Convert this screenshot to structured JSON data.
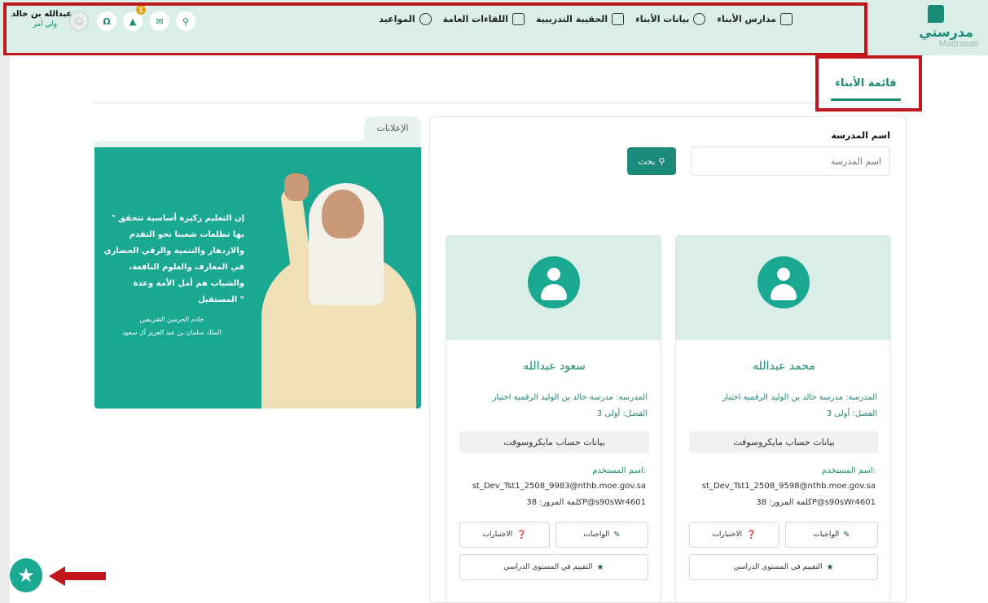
{
  "brand": {
    "name_ar": "مدرستي",
    "name_en": "Madrasati"
  },
  "nav": [
    {
      "label": "مدارس الأبناء",
      "icon": "school-icon"
    },
    {
      "label": "بيانات الأبناء",
      "icon": "children-icon"
    },
    {
      "label": "الحقيبة التدريبية",
      "icon": "bag-icon"
    },
    {
      "label": "اللقاءات العامة",
      "icon": "meeting-icon"
    },
    {
      "label": "المواعيد",
      "icon": "clock-icon"
    }
  ],
  "user": {
    "name": "عبدالله بن خالد",
    "role": "ولي أمر"
  },
  "toolbar": {
    "notifications_count": "1"
  },
  "tab": {
    "label": "قائمة الأبناء"
  },
  "announcements": {
    "tab_label": "الإعلانات",
    "quote": "\" إن التعليم ركيزة أساسية تتحقق بها تطلعات شعبنا نحو التقدم والازدهار والتنمية والرقي الحضاري في المعارف والعلوم النافعة، والشباب هم أمل الأمة وعدة المستقبل \"",
    "attribution_title": "خادم الحرمين الشريفين",
    "attribution_name": "الملك سلمان بن عبد العزيز آل سعود"
  },
  "search": {
    "label": "اسم المدرسة",
    "placeholder": "اسم المدرسة",
    "button": "بحث"
  },
  "children": [
    {
      "name": "محمد عبدالله",
      "school_label": "المدرسة:",
      "school": "مدرسة خالد بن الوليد الرقمية اختبار",
      "class_label": "الفصل:",
      "class": "أولى 3",
      "ms_title": "بيانات حساب مايكروسوفت",
      "username_label": "اسم المستخدم:",
      "username": "st_Dev_Tst1_2508_9598@nthb.moe.gov.sa",
      "password_label": "كلمة المرور:",
      "password": "38P@s90sWr4601",
      "homework": "الواجبات",
      "tests": "الاختبارات",
      "evaluation": "التقييم في المستوى الدراسي"
    },
    {
      "name": "سعود عبدالله",
      "school_label": "المدرسة:",
      "school": "مدرسة خالد بن الوليد الرقمية اختبار",
      "class_label": "الفصل:",
      "class": "أولى 3",
      "ms_title": "بيانات حساب مايكروسوفت",
      "username_label": "اسم المستخدم:",
      "username": "st_Dev_Tst1_2508_9983@nthb.moe.gov.sa",
      "password_label": "كلمة المرور:",
      "password": "38P@s90sWr4601",
      "homework": "الواجبات",
      "tests": "الاختبارات",
      "evaluation": "التقييم في المستوى الدراسي"
    }
  ],
  "colors": {
    "accent": "#1b8a78",
    "header": "#d8eee7",
    "highlight": "#c0161c"
  }
}
